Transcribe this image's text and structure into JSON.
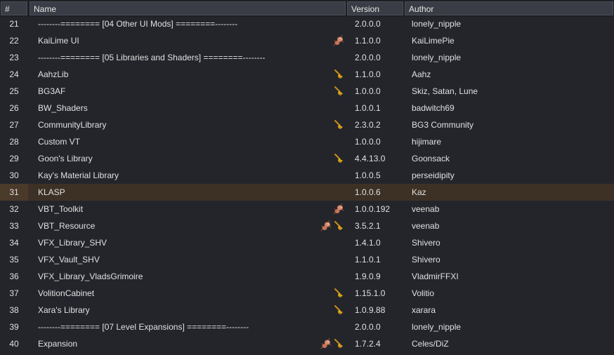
{
  "columns": {
    "num": "#",
    "name": "Name",
    "version": "Version",
    "author": "Author"
  },
  "rows": [
    {
      "num": "21",
      "name": "--------======== [04 Other UI Mods] ========--------",
      "version": "2.0.0.0",
      "author": "lonely_nipple",
      "icons": []
    },
    {
      "num": "22",
      "name": "KaiLime UI",
      "version": "1.1.0.0",
      "author": "KaiLimePie",
      "icons": [
        "bug-icon"
      ]
    },
    {
      "num": "23",
      "name": "--------======== [05 Libraries and Shaders] ========--------",
      "version": "2.0.0.0",
      "author": "lonely_nipple",
      "icons": []
    },
    {
      "num": "24",
      "name": "AahzLib",
      "version": "1.1.0.0",
      "author": "Aahz",
      "icons": [
        "broom-icon"
      ]
    },
    {
      "num": "25",
      "name": "BG3AF",
      "version": "1.0.0.0",
      "author": "Skiz, Satan, Lune",
      "icons": [
        "broom-icon"
      ]
    },
    {
      "num": "26",
      "name": "BW_Shaders",
      "version": "1.0.0.1",
      "author": "badwitch69",
      "icons": []
    },
    {
      "num": "27",
      "name": "CommunityLibrary",
      "version": "2.3.0.2",
      "author": "BG3 Community",
      "icons": [
        "broom-icon"
      ]
    },
    {
      "num": "28",
      "name": "Custom VT",
      "version": "1.0.0.0",
      "author": "hijimare",
      "icons": []
    },
    {
      "num": "29",
      "name": "Goon's Library",
      "version": "4.4.13.0",
      "author": "Goonsack",
      "icons": [
        "broom-icon"
      ]
    },
    {
      "num": "30",
      "name": "Kay's Material Library",
      "version": "1.0.0.5",
      "author": "perseidipity",
      "icons": []
    },
    {
      "num": "31",
      "name": "KLASP",
      "version": "1.0.0.6",
      "author": "Kaz",
      "icons": [],
      "selected": true
    },
    {
      "num": "32",
      "name": "VBT_Toolkit",
      "version": "1.0.0.192",
      "author": "veenab",
      "icons": [
        "bug-icon"
      ]
    },
    {
      "num": "33",
      "name": "VBT_Resource",
      "version": "3.5.2.1",
      "author": "veenab",
      "icons": [
        "bug-icon",
        "broom-icon"
      ]
    },
    {
      "num": "34",
      "name": "VFX_Library_SHV",
      "version": "1.4.1.0",
      "author": "Shivero",
      "icons": []
    },
    {
      "num": "35",
      "name": "VFX_Vault_SHV",
      "version": "1.1.0.1",
      "author": "Shivero",
      "icons": []
    },
    {
      "num": "36",
      "name": "VFX_Library_VladsGrimoire",
      "version": "1.9.0.9",
      "author": "VladmirFFXI",
      "icons": []
    },
    {
      "num": "37",
      "name": "VolitionCabinet",
      "version": "1.15.1.0",
      "author": "Volitio",
      "icons": [
        "broom-icon"
      ]
    },
    {
      "num": "38",
      "name": "Xara's Library",
      "version": "1.0.9.88",
      "author": "xarara",
      "icons": [
        "broom-icon"
      ]
    },
    {
      "num": "39",
      "name": "--------======== [07 Level Expansions] ========--------",
      "version": "2.0.0.0",
      "author": "lonely_nipple",
      "icons": []
    },
    {
      "num": "40",
      "name": "Expansion",
      "version": "1.7.2.4",
      "author": "Celes/DiZ",
      "icons": [
        "bug-icon",
        "broom-icon"
      ]
    }
  ],
  "colors": {
    "background": "#23252b",
    "selected_row": "#3d3126",
    "header": "#3a3d45",
    "broom": "#e0a81c",
    "bug": "#d98a6a"
  }
}
